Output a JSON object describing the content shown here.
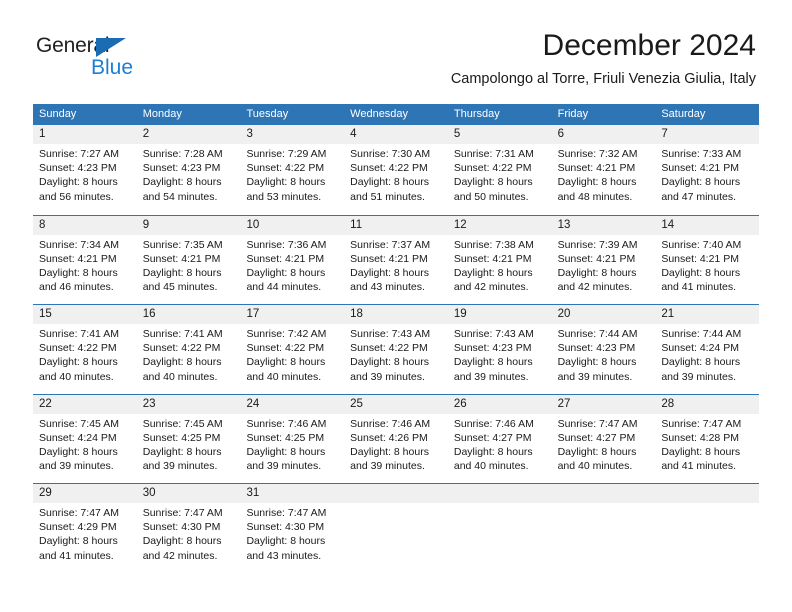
{
  "brand": {
    "name_part1": "General",
    "name_part2": "Blue",
    "triangle_icon": "triangle-icon",
    "accent_color": "#1b7fd4"
  },
  "header": {
    "title": "December 2024",
    "subtitle": "Campolongo al Torre, Friuli Venezia Giulia, Italy"
  },
  "colors": {
    "header_blue": "#2e75b6",
    "day_band_gray": "#f0f0f0",
    "text": "#1a1a1a"
  },
  "weekdays": [
    "Sunday",
    "Monday",
    "Tuesday",
    "Wednesday",
    "Thursday",
    "Friday",
    "Saturday"
  ],
  "weeks": [
    [
      {
        "day": "1",
        "sunrise": "Sunrise: 7:27 AM",
        "sunset": "Sunset: 4:23 PM",
        "daylight1": "Daylight: 8 hours",
        "daylight2": "and 56 minutes."
      },
      {
        "day": "2",
        "sunrise": "Sunrise: 7:28 AM",
        "sunset": "Sunset: 4:23 PM",
        "daylight1": "Daylight: 8 hours",
        "daylight2": "and 54 minutes."
      },
      {
        "day": "3",
        "sunrise": "Sunrise: 7:29 AM",
        "sunset": "Sunset: 4:22 PM",
        "daylight1": "Daylight: 8 hours",
        "daylight2": "and 53 minutes."
      },
      {
        "day": "4",
        "sunrise": "Sunrise: 7:30 AM",
        "sunset": "Sunset: 4:22 PM",
        "daylight1": "Daylight: 8 hours",
        "daylight2": "and 51 minutes."
      },
      {
        "day": "5",
        "sunrise": "Sunrise: 7:31 AM",
        "sunset": "Sunset: 4:22 PM",
        "daylight1": "Daylight: 8 hours",
        "daylight2": "and 50 minutes."
      },
      {
        "day": "6",
        "sunrise": "Sunrise: 7:32 AM",
        "sunset": "Sunset: 4:21 PM",
        "daylight1": "Daylight: 8 hours",
        "daylight2": "and 48 minutes."
      },
      {
        "day": "7",
        "sunrise": "Sunrise: 7:33 AM",
        "sunset": "Sunset: 4:21 PM",
        "daylight1": "Daylight: 8 hours",
        "daylight2": "and 47 minutes."
      }
    ],
    [
      {
        "day": "8",
        "sunrise": "Sunrise: 7:34 AM",
        "sunset": "Sunset: 4:21 PM",
        "daylight1": "Daylight: 8 hours",
        "daylight2": "and 46 minutes."
      },
      {
        "day": "9",
        "sunrise": "Sunrise: 7:35 AM",
        "sunset": "Sunset: 4:21 PM",
        "daylight1": "Daylight: 8 hours",
        "daylight2": "and 45 minutes."
      },
      {
        "day": "10",
        "sunrise": "Sunrise: 7:36 AM",
        "sunset": "Sunset: 4:21 PM",
        "daylight1": "Daylight: 8 hours",
        "daylight2": "and 44 minutes."
      },
      {
        "day": "11",
        "sunrise": "Sunrise: 7:37 AM",
        "sunset": "Sunset: 4:21 PM",
        "daylight1": "Daylight: 8 hours",
        "daylight2": "and 43 minutes."
      },
      {
        "day": "12",
        "sunrise": "Sunrise: 7:38 AM",
        "sunset": "Sunset: 4:21 PM",
        "daylight1": "Daylight: 8 hours",
        "daylight2": "and 42 minutes."
      },
      {
        "day": "13",
        "sunrise": "Sunrise: 7:39 AM",
        "sunset": "Sunset: 4:21 PM",
        "daylight1": "Daylight: 8 hours",
        "daylight2": "and 42 minutes."
      },
      {
        "day": "14",
        "sunrise": "Sunrise: 7:40 AM",
        "sunset": "Sunset: 4:21 PM",
        "daylight1": "Daylight: 8 hours",
        "daylight2": "and 41 minutes."
      }
    ],
    [
      {
        "day": "15",
        "sunrise": "Sunrise: 7:41 AM",
        "sunset": "Sunset: 4:22 PM",
        "daylight1": "Daylight: 8 hours",
        "daylight2": "and 40 minutes."
      },
      {
        "day": "16",
        "sunrise": "Sunrise: 7:41 AM",
        "sunset": "Sunset: 4:22 PM",
        "daylight1": "Daylight: 8 hours",
        "daylight2": "and 40 minutes."
      },
      {
        "day": "17",
        "sunrise": "Sunrise: 7:42 AM",
        "sunset": "Sunset: 4:22 PM",
        "daylight1": "Daylight: 8 hours",
        "daylight2": "and 40 minutes."
      },
      {
        "day": "18",
        "sunrise": "Sunrise: 7:43 AM",
        "sunset": "Sunset: 4:22 PM",
        "daylight1": "Daylight: 8 hours",
        "daylight2": "and 39 minutes."
      },
      {
        "day": "19",
        "sunrise": "Sunrise: 7:43 AM",
        "sunset": "Sunset: 4:23 PM",
        "daylight1": "Daylight: 8 hours",
        "daylight2": "and 39 minutes."
      },
      {
        "day": "20",
        "sunrise": "Sunrise: 7:44 AM",
        "sunset": "Sunset: 4:23 PM",
        "daylight1": "Daylight: 8 hours",
        "daylight2": "and 39 minutes."
      },
      {
        "day": "21",
        "sunrise": "Sunrise: 7:44 AM",
        "sunset": "Sunset: 4:24 PM",
        "daylight1": "Daylight: 8 hours",
        "daylight2": "and 39 minutes."
      }
    ],
    [
      {
        "day": "22",
        "sunrise": "Sunrise: 7:45 AM",
        "sunset": "Sunset: 4:24 PM",
        "daylight1": "Daylight: 8 hours",
        "daylight2": "and 39 minutes."
      },
      {
        "day": "23",
        "sunrise": "Sunrise: 7:45 AM",
        "sunset": "Sunset: 4:25 PM",
        "daylight1": "Daylight: 8 hours",
        "daylight2": "and 39 minutes."
      },
      {
        "day": "24",
        "sunrise": "Sunrise: 7:46 AM",
        "sunset": "Sunset: 4:25 PM",
        "daylight1": "Daylight: 8 hours",
        "daylight2": "and 39 minutes."
      },
      {
        "day": "25",
        "sunrise": "Sunrise: 7:46 AM",
        "sunset": "Sunset: 4:26 PM",
        "daylight1": "Daylight: 8 hours",
        "daylight2": "and 39 minutes."
      },
      {
        "day": "26",
        "sunrise": "Sunrise: 7:46 AM",
        "sunset": "Sunset: 4:27 PM",
        "daylight1": "Daylight: 8 hours",
        "daylight2": "and 40 minutes."
      },
      {
        "day": "27",
        "sunrise": "Sunrise: 7:47 AM",
        "sunset": "Sunset: 4:27 PM",
        "daylight1": "Daylight: 8 hours",
        "daylight2": "and 40 minutes."
      },
      {
        "day": "28",
        "sunrise": "Sunrise: 7:47 AM",
        "sunset": "Sunset: 4:28 PM",
        "daylight1": "Daylight: 8 hours",
        "daylight2": "and 41 minutes."
      }
    ],
    [
      {
        "day": "29",
        "sunrise": "Sunrise: 7:47 AM",
        "sunset": "Sunset: 4:29 PM",
        "daylight1": "Daylight: 8 hours",
        "daylight2": "and 41 minutes."
      },
      {
        "day": "30",
        "sunrise": "Sunrise: 7:47 AM",
        "sunset": "Sunset: 4:30 PM",
        "daylight1": "Daylight: 8 hours",
        "daylight2": "and 42 minutes."
      },
      {
        "day": "31",
        "sunrise": "Sunrise: 7:47 AM",
        "sunset": "Sunset: 4:30 PM",
        "daylight1": "Daylight: 8 hours",
        "daylight2": "and 43 minutes."
      },
      {
        "day": "",
        "sunrise": "",
        "sunset": "",
        "daylight1": "",
        "daylight2": ""
      },
      {
        "day": "",
        "sunrise": "",
        "sunset": "",
        "daylight1": "",
        "daylight2": ""
      },
      {
        "day": "",
        "sunrise": "",
        "sunset": "",
        "daylight1": "",
        "daylight2": ""
      },
      {
        "day": "",
        "sunrise": "",
        "sunset": "",
        "daylight1": "",
        "daylight2": ""
      }
    ]
  ]
}
